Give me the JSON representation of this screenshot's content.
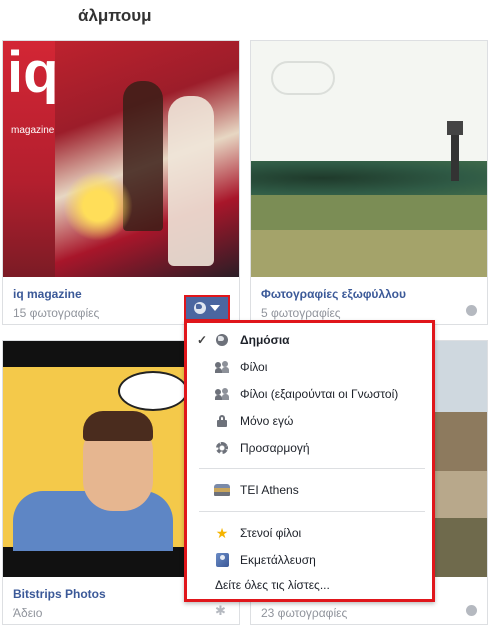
{
  "page_title": "άλμπουμ",
  "albums": [
    {
      "title": "iq magazine",
      "count": "15 φωτογραφίες",
      "thumb_text": "iq",
      "thumb_sub": "magazine"
    },
    {
      "title": "Φωτογραφίες εξωφύλλου",
      "count": "5 φωτογραφίες"
    },
    {
      "title": "Bitstrips Photos",
      "count": "Άδειο"
    },
    {
      "title": "",
      "count": "23 φωτογραφίες"
    }
  ],
  "privacy_menu": {
    "items": [
      {
        "label": "Δημόσια",
        "icon": "globe-icon",
        "selected": true
      },
      {
        "label": "Φίλοι",
        "icon": "friends-icon"
      },
      {
        "label": "Φίλοι (εξαιρούνται οι Γνωστοί)",
        "icon": "friends-except-icon"
      },
      {
        "label": "Μόνο εγώ",
        "icon": "lock-icon"
      },
      {
        "label": "Προσαρμογή",
        "icon": "gear-icon"
      }
    ],
    "networks": [
      {
        "label": "TEI Athens",
        "icon": "school-icon"
      }
    ],
    "lists": [
      {
        "label": "Στενοί φίλοι",
        "icon": "star-icon"
      },
      {
        "label": "Εκμετάλλευση",
        "icon": "acquaintance-icon"
      }
    ],
    "see_all": "Δείτε όλες τις λίστες...",
    "check_glyph": "✓"
  },
  "colors": {
    "accent": "#3b5998",
    "highlight": "#e0161b",
    "button": "#4b66a0"
  }
}
